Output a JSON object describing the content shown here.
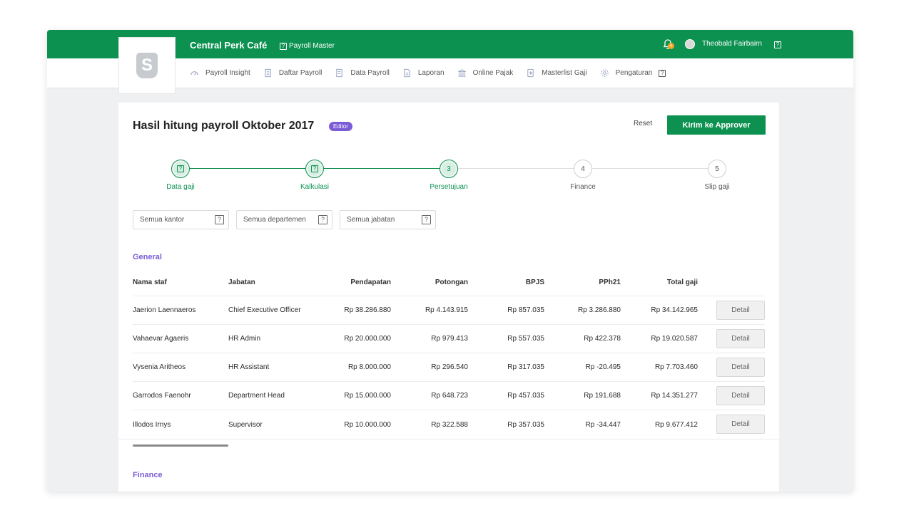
{
  "header": {
    "company": "Central Perk Café",
    "product": "Payroll Master",
    "notification_count": "4",
    "user_name": "Theobald Fairbairn",
    "logo_letter": "S",
    "brand_color": "#0c9150"
  },
  "nav": {
    "items": [
      {
        "label": "Payroll Insight",
        "icon": "gauge-icon"
      },
      {
        "label": "Daftar Payroll",
        "icon": "list-document-icon"
      },
      {
        "label": "Data Payroll",
        "icon": "data-document-icon"
      },
      {
        "label": "Laporan",
        "icon": "report-icon"
      },
      {
        "label": "Online Pajak",
        "icon": "bank-icon"
      },
      {
        "label": "Masterlist Gaji",
        "icon": "salary-doc-icon"
      },
      {
        "label": "Pengaturan",
        "icon": "gear-icon"
      }
    ]
  },
  "page": {
    "title": "Hasil hitung payroll Oktober 2017",
    "badge": "Editor",
    "reset_label": "Reset",
    "send_label": "Kirim ke Approver",
    "badge_color": "#7b5cd6"
  },
  "steps": [
    {
      "label": "Data gaji",
      "marker": "?",
      "state": "done"
    },
    {
      "label": "Kalkulasi",
      "marker": "?",
      "state": "done"
    },
    {
      "label": "Persetujuan",
      "marker": "3",
      "state": "done"
    },
    {
      "label": "Finance",
      "marker": "4",
      "state": "pending"
    },
    {
      "label": "Slip gaji",
      "marker": "5",
      "state": "pending"
    }
  ],
  "filters": [
    {
      "label": "Semua kantor"
    },
    {
      "label": "Semua departemen"
    },
    {
      "label": "Semua jabatan"
    }
  ],
  "sections": {
    "general": "General",
    "finance": "Finance"
  },
  "table": {
    "columns": [
      "Nama staf",
      "Jabatan",
      "Pendapatan",
      "Potongan",
      "BPJS",
      "PPh21",
      "Total gaji"
    ],
    "detail_label": "Detail",
    "rows": [
      {
        "name": "Jaerion Laennaeros",
        "position": "Chief Executive Officer",
        "income": "Rp 38.286.880",
        "deduction": "Rp 4.143.915",
        "bpjs": "Rp 857.035",
        "pph21": "Rp 3.286.880",
        "total": "Rp 34.142.965"
      },
      {
        "name": "Vahaevar Agaeris",
        "position": "HR Admin",
        "income": "Rp 20.000.000",
        "deduction": "Rp 979.413",
        "bpjs": "Rp 557.035",
        "pph21": "Rp 422.378",
        "total": "Rp 19.020.587"
      },
      {
        "name": "Vysenia Aritheos",
        "position": "HR Assistant",
        "income": "Rp 8.000.000",
        "deduction": "Rp 296.540",
        "bpjs": "Rp 317.035",
        "pph21": "Rp -20.495",
        "total": "Rp 7.703.460"
      },
      {
        "name": "Garrodos Faenohr",
        "position": "Department Head",
        "income": "Rp 15.000.000",
        "deduction": "Rp 648.723",
        "bpjs": "Rp 457.035",
        "pph21": "Rp 191.688",
        "total": "Rp 14.351.277"
      },
      {
        "name": "Illodos Irnys",
        "position": "Supervisor",
        "income": "Rp 10.000.000",
        "deduction": "Rp 322.588",
        "bpjs": "Rp 357.035",
        "pph21": "Rp -34.447",
        "total": "Rp 9.677.412"
      }
    ]
  }
}
